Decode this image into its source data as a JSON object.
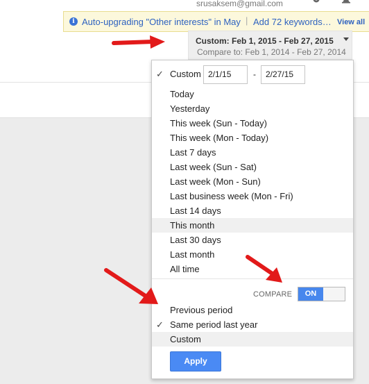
{
  "header": {
    "account_email": "srusaksem@gmail.com",
    "icons": [
      "gear-icon",
      "bell-icon"
    ]
  },
  "notice": {
    "icon": "info-icon",
    "message": "Auto-upgrading \"Other interests\" in May",
    "separator": "|",
    "message2": "Add 72 keywords…",
    "link": "View all"
  },
  "date_range": {
    "label": "Custom: Feb 1, 2015 - Feb 27, 2015",
    "compare": "Compare to: Feb 1, 2014 - Feb 27, 2014"
  },
  "dropdown": {
    "custom_label": "Custom",
    "start_date": "2/1/15",
    "end_date": "2/27/15",
    "dash": "-",
    "presets": [
      "Today",
      "Yesterday",
      "This week (Sun - Today)",
      "This week (Mon - Today)",
      "Last 7 days",
      "Last week (Sun - Sat)",
      "Last week (Mon - Sun)",
      "Last business week (Mon - Fri)",
      "Last 14 days",
      "This month",
      "Last 30 days",
      "Last month",
      "All time"
    ],
    "highlighted_preset": "This month",
    "compare_label": "COMPARE",
    "compare_toggle": "ON",
    "compare_options": [
      "Previous period",
      "Same period last year",
      "Custom"
    ],
    "selected_compare": "Same period last year",
    "apply_label": "Apply"
  },
  "colors": {
    "accent": "#4a8af4",
    "notice_bg": "#fcf8dc",
    "link": "#2e62c0",
    "annotation_arrow": "#e21a1a"
  }
}
